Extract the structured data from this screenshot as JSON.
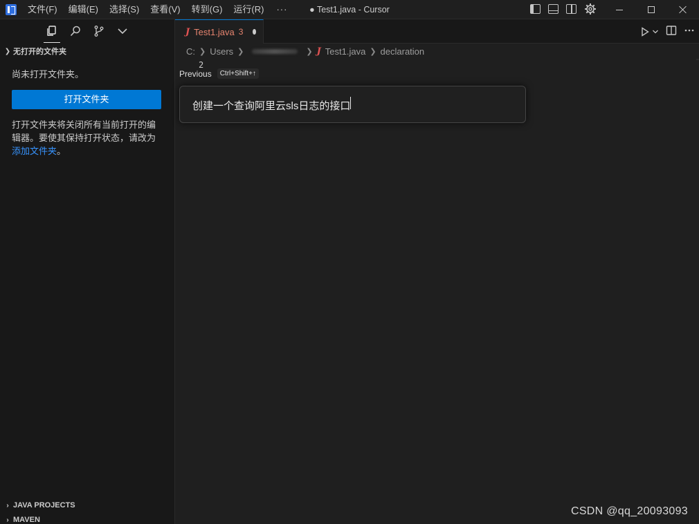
{
  "titlebar": {
    "menu": [
      "文件(F)",
      "编辑(E)",
      "选择(S)",
      "查看(V)",
      "转到(G)",
      "运行(R)"
    ],
    "more": "···",
    "title": "● Test1.java - Cursor"
  },
  "sidebar": {
    "section_title": "无打开的文件夹",
    "empty_message": "尚未打开文件夹。",
    "open_folder_button": "打开文件夹",
    "hint_text": "打开文件夹将关闭所有当前打开的编辑器。要使其保持打开状态，请改为",
    "hint_link": "添加文件夹",
    "hint_end": "。",
    "bottom_sections": [
      "JAVA PROJECTS",
      "MAVEN"
    ]
  },
  "editor": {
    "tab": {
      "name": "Test1.java",
      "problems": "3"
    },
    "breadcrumb": {
      "drive": "C:",
      "users": "Users",
      "file": "Test1.java",
      "symbol": "declaration"
    },
    "line_number": "2",
    "previous_label": "Previous",
    "previous_shortcut": "Ctrl+Shift+↑",
    "prompt_text": "创建一个查询阿里云sls日志的接口"
  },
  "watermark": "CSDN @qq_20093093",
  "colors": {
    "accent": "#0078d4",
    "java_red": "#e05252",
    "link": "#3794ff"
  }
}
